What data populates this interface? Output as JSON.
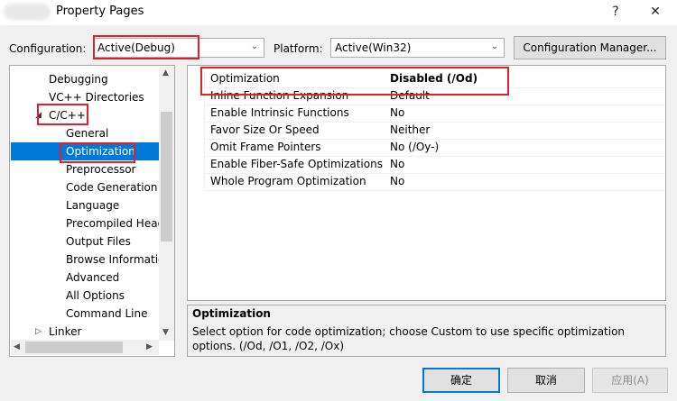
{
  "window": {
    "title": "Property Pages",
    "help_glyph": "?",
    "close_glyph": "✕"
  },
  "config_row": {
    "configuration_label": "Configuration:",
    "configuration_value": "Active(Debug)",
    "platform_label": "Platform:",
    "platform_value": "Active(Win32)",
    "config_manager_label": "Configuration Manager..."
  },
  "tree": {
    "items": [
      {
        "label": "Debugging",
        "level": 1
      },
      {
        "label": "VC++ Directories",
        "level": 1
      },
      {
        "label": "C/C++",
        "level": 1,
        "expanded": true
      },
      {
        "label": "General",
        "level": 2
      },
      {
        "label": "Optimization",
        "level": 2,
        "selected": true
      },
      {
        "label": "Preprocessor",
        "level": 2
      },
      {
        "label": "Code Generation",
        "level": 2
      },
      {
        "label": "Language",
        "level": 2
      },
      {
        "label": "Precompiled Head",
        "level": 2
      },
      {
        "label": "Output Files",
        "level": 2
      },
      {
        "label": "Browse Informatio",
        "level": 2
      },
      {
        "label": "Advanced",
        "level": 2
      },
      {
        "label": "All Options",
        "level": 2
      },
      {
        "label": "Command Line",
        "level": 2
      },
      {
        "label": "Linker",
        "level": 1,
        "expanded": false
      }
    ]
  },
  "properties": [
    {
      "name": "Optimization",
      "value": "Disabled (/Od)"
    },
    {
      "name": "Inline Function Expansion",
      "value": "Default"
    },
    {
      "name": "Enable Intrinsic Functions",
      "value": "No"
    },
    {
      "name": "Favor Size Or Speed",
      "value": "Neither"
    },
    {
      "name": "Omit Frame Pointers",
      "value": "No (/Oy-)"
    },
    {
      "name": "Enable Fiber-Safe Optimizations",
      "value": "No"
    },
    {
      "name": "Whole Program Optimization",
      "value": "No"
    }
  ],
  "description": {
    "title": "Optimization",
    "text": "Select option for code optimization; choose Custom to use specific optimization options. (/Od, /O1, /O2, /Ox)"
  },
  "buttons": {
    "ok": "确定",
    "cancel": "取消",
    "apply": "应用(A)"
  },
  "colors": {
    "selection": "#0078d7",
    "annotation_red": "#e0202a"
  }
}
